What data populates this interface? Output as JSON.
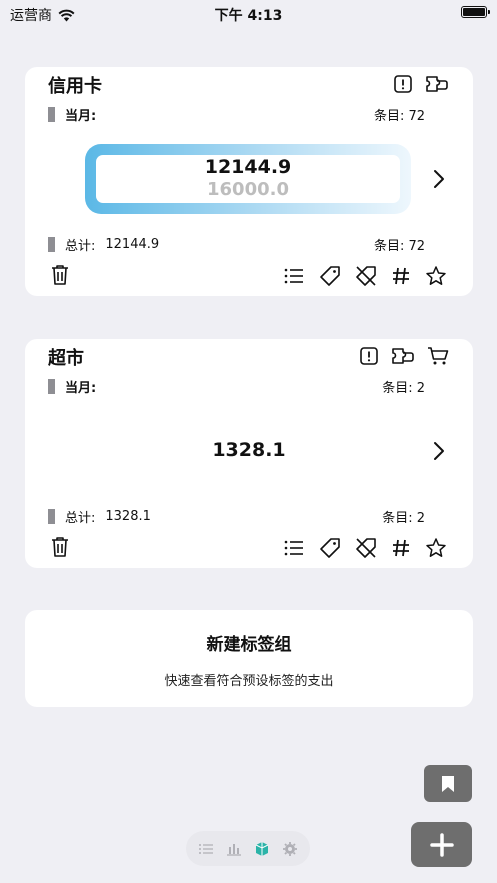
{
  "status_bar": {
    "carrier": "运营商",
    "time": "下午 4:13"
  },
  "groups": [
    {
      "title": "信用卡",
      "month_label": "当月:",
      "month_count_label": "条目: 72",
      "spent": "12144.9",
      "budget": "16000.0",
      "budget_progress": 0.76,
      "total_label": "总计:",
      "total_value": "12144.9",
      "total_count_label": "条目: 72"
    },
    {
      "title": "超市",
      "month_label": "当月:",
      "month_count_label": "条目: 2",
      "spent": "1328.1",
      "total_label": "总计:",
      "total_value": "1328.1",
      "total_count_label": "条目: 2"
    }
  ],
  "new_group": {
    "title": "新建标签组",
    "subtitle": "快速查看符合预设标签的支出"
  },
  "colors": {
    "accent": "#5bb8e6",
    "tab_active": "#2bb3a8",
    "fab": "#6e6e6e"
  },
  "tabbar": {
    "items": [
      "list-icon",
      "chart-icon",
      "tag-group-icon",
      "settings-icon"
    ],
    "active": 2
  }
}
